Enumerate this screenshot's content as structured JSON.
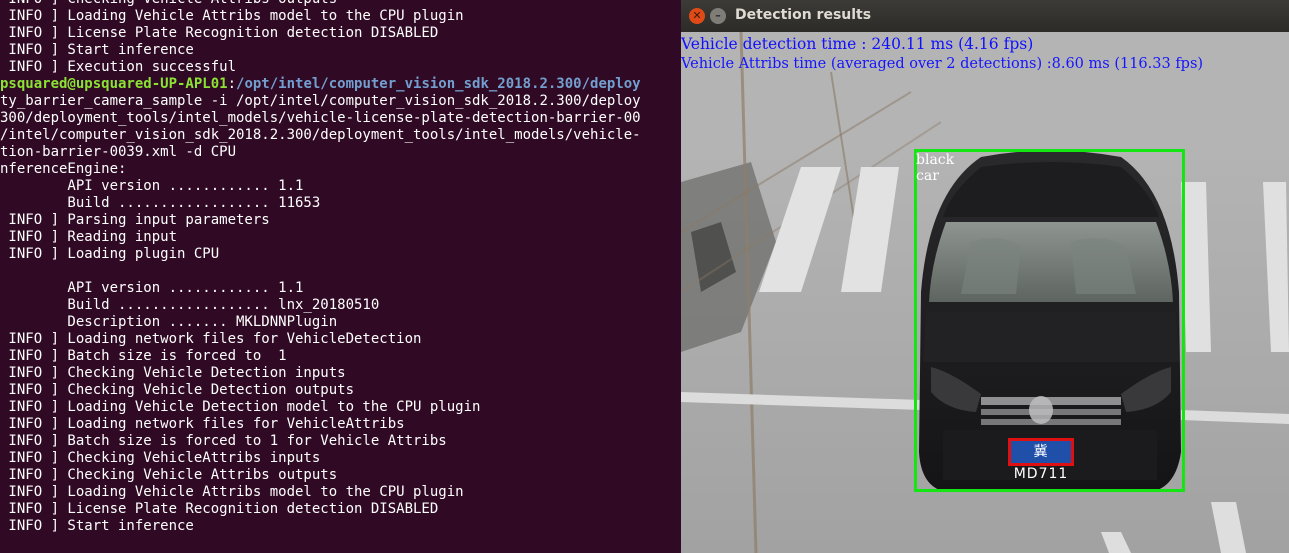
{
  "terminal": {
    "lines": [
      " INFO ] Checking Vehicle Attribs outputs",
      " INFO ] Loading Vehicle Attribs model to the CPU plugin",
      " INFO ] License Plate Recognition detection DISABLED",
      " INFO ] Start inference",
      " INFO ] Execution successful",
      "",
      "ty_barrier_camera_sample -i /opt/intel/computer_vision_sdk_2018.2.300/deploy",
      "300/deployment_tools/intel_models/vehicle-license-plate-detection-barrier-00",
      "/intel/computer_vision_sdk_2018.2.300/deployment_tools/intel_models/vehicle-",
      "tion-barrier-0039.xml -d CPU",
      "nferenceEngine:",
      "        API version ............ 1.1",
      "        Build .................. 11653",
      " INFO ] Parsing input parameters",
      " INFO ] Reading input",
      " INFO ] Loading plugin CPU",
      "",
      "        API version ............ 1.1",
      "        Build .................. lnx_20180510",
      "        Description ....... MKLDNNPlugin",
      " INFO ] Loading network files for VehicleDetection",
      " INFO ] Batch size is forced to  1",
      " INFO ] Checking Vehicle Detection inputs",
      " INFO ] Checking Vehicle Detection outputs",
      " INFO ] Loading Vehicle Detection model to the CPU plugin",
      " INFO ] Loading network files for VehicleAttribs",
      " INFO ] Batch size is forced to 1 for Vehicle Attribs",
      " INFO ] Checking VehicleAttribs inputs",
      " INFO ] Checking Vehicle Attribs outputs",
      " INFO ] Loading Vehicle Attribs model to the CPU plugin",
      " INFO ] License Plate Recognition detection DISABLED",
      " INFO ] Start inference"
    ],
    "prompt": {
      "user_host": "psquared@upsquared-UP-APL01",
      "colon": ":",
      "path": "/opt/intel/computer_vision_sdk_2018.2.300/deploy"
    },
    "colors": {
      "background": "#300a24",
      "text": "#ffffff",
      "user_host": "#8ae234",
      "path": "#729fcf"
    }
  },
  "window": {
    "title": "Detection results",
    "close_icon": "close-icon",
    "minimize_icon": "minimize-icon",
    "overlay": {
      "vehicle_detection_time": "Vehicle detection time  : 240.11 ms (4.16 fps)",
      "vehicle_attribs_time": "Vehicle Attribs time (averaged over 2 detections) :8.60 ms (116.33 fps)"
    },
    "detection": {
      "color_label": "black",
      "type_label": "car",
      "box_color": "#14e614"
    },
    "plate": {
      "text": "冀 MD711",
      "box_color": "#e01010"
    }
  }
}
